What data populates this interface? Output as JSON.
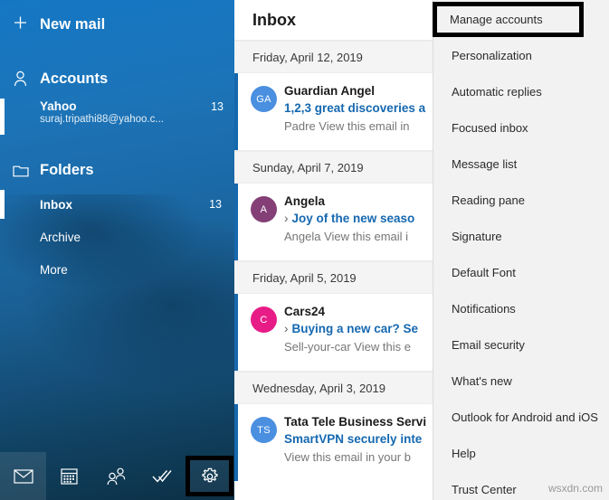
{
  "sidebar": {
    "new_mail": {
      "label": "New mail",
      "icon": "plus-icon"
    },
    "accounts": {
      "label": "Accounts",
      "icon": "person-icon",
      "items": [
        {
          "name": "Yahoo",
          "email": "suraj.tripathi88@yahoo.c...",
          "count": "13",
          "selected": true
        }
      ]
    },
    "folders": {
      "label": "Folders",
      "icon": "folder-icon",
      "items": [
        {
          "name": "Inbox",
          "count": "13",
          "selected": true
        },
        {
          "name": "Archive",
          "count": "",
          "selected": false
        },
        {
          "name": "More",
          "count": "",
          "selected": false
        }
      ]
    },
    "iconbar": [
      {
        "name": "mail-icon",
        "active": true,
        "highlighted": false
      },
      {
        "name": "calendar-icon",
        "active": false,
        "highlighted": false
      },
      {
        "name": "people-icon",
        "active": false,
        "highlighted": false
      },
      {
        "name": "tasks-icon",
        "active": false,
        "highlighted": false
      },
      {
        "name": "settings-gear-icon",
        "active": false,
        "highlighted": true
      }
    ]
  },
  "message_list": {
    "title": "Inbox",
    "groups": [
      {
        "date": "Friday, April 12, 2019",
        "messages": [
          {
            "sender": "Guardian Angel",
            "subject": "1,2,3 great discoveries a",
            "preview": "Padre View this email in",
            "initials": "GA",
            "avatar_color": "#4a8fe0",
            "chevron": false,
            "unread": true
          }
        ]
      },
      {
        "date": "Sunday, April 7, 2019",
        "messages": [
          {
            "sender": "Angela",
            "subject": "Joy of the new seaso",
            "preview": "Angela View this email i",
            "initials": "A",
            "avatar_color": "#833f76",
            "chevron": true,
            "unread": true
          }
        ]
      },
      {
        "date": "Friday, April 5, 2019",
        "messages": [
          {
            "sender": "Cars24",
            "subject": "Buying a new car? Se",
            "preview": "Sell-your-car View this e",
            "initials": "C",
            "avatar_color": "#e81c86",
            "chevron": true,
            "unread": true
          }
        ]
      },
      {
        "date": "Wednesday, April 3, 2019",
        "messages": [
          {
            "sender": "Tata Tele Business Servi",
            "subject": "SmartVPN securely inte",
            "preview": "View this email in your b",
            "initials": "TS",
            "avatar_color": "#4a8fe0",
            "chevron": false,
            "unread": true
          }
        ]
      }
    ]
  },
  "settings_panel": {
    "highlighted_item": "Manage accounts",
    "items": [
      "Personalization",
      "Automatic replies",
      "Focused inbox",
      "Message list",
      "Reading pane",
      "Signature",
      "Default Font",
      "Notifications",
      "Email security",
      "What's new",
      "Outlook for Android and iOS",
      "Help",
      "Trust Center"
    ]
  },
  "watermark": "wsxdn.com",
  "colors": {
    "sidebar_blue": "#1577c4",
    "accent_link": "#1568b0",
    "unread_bar": "#1668ad",
    "highlight_border": "#000000"
  }
}
